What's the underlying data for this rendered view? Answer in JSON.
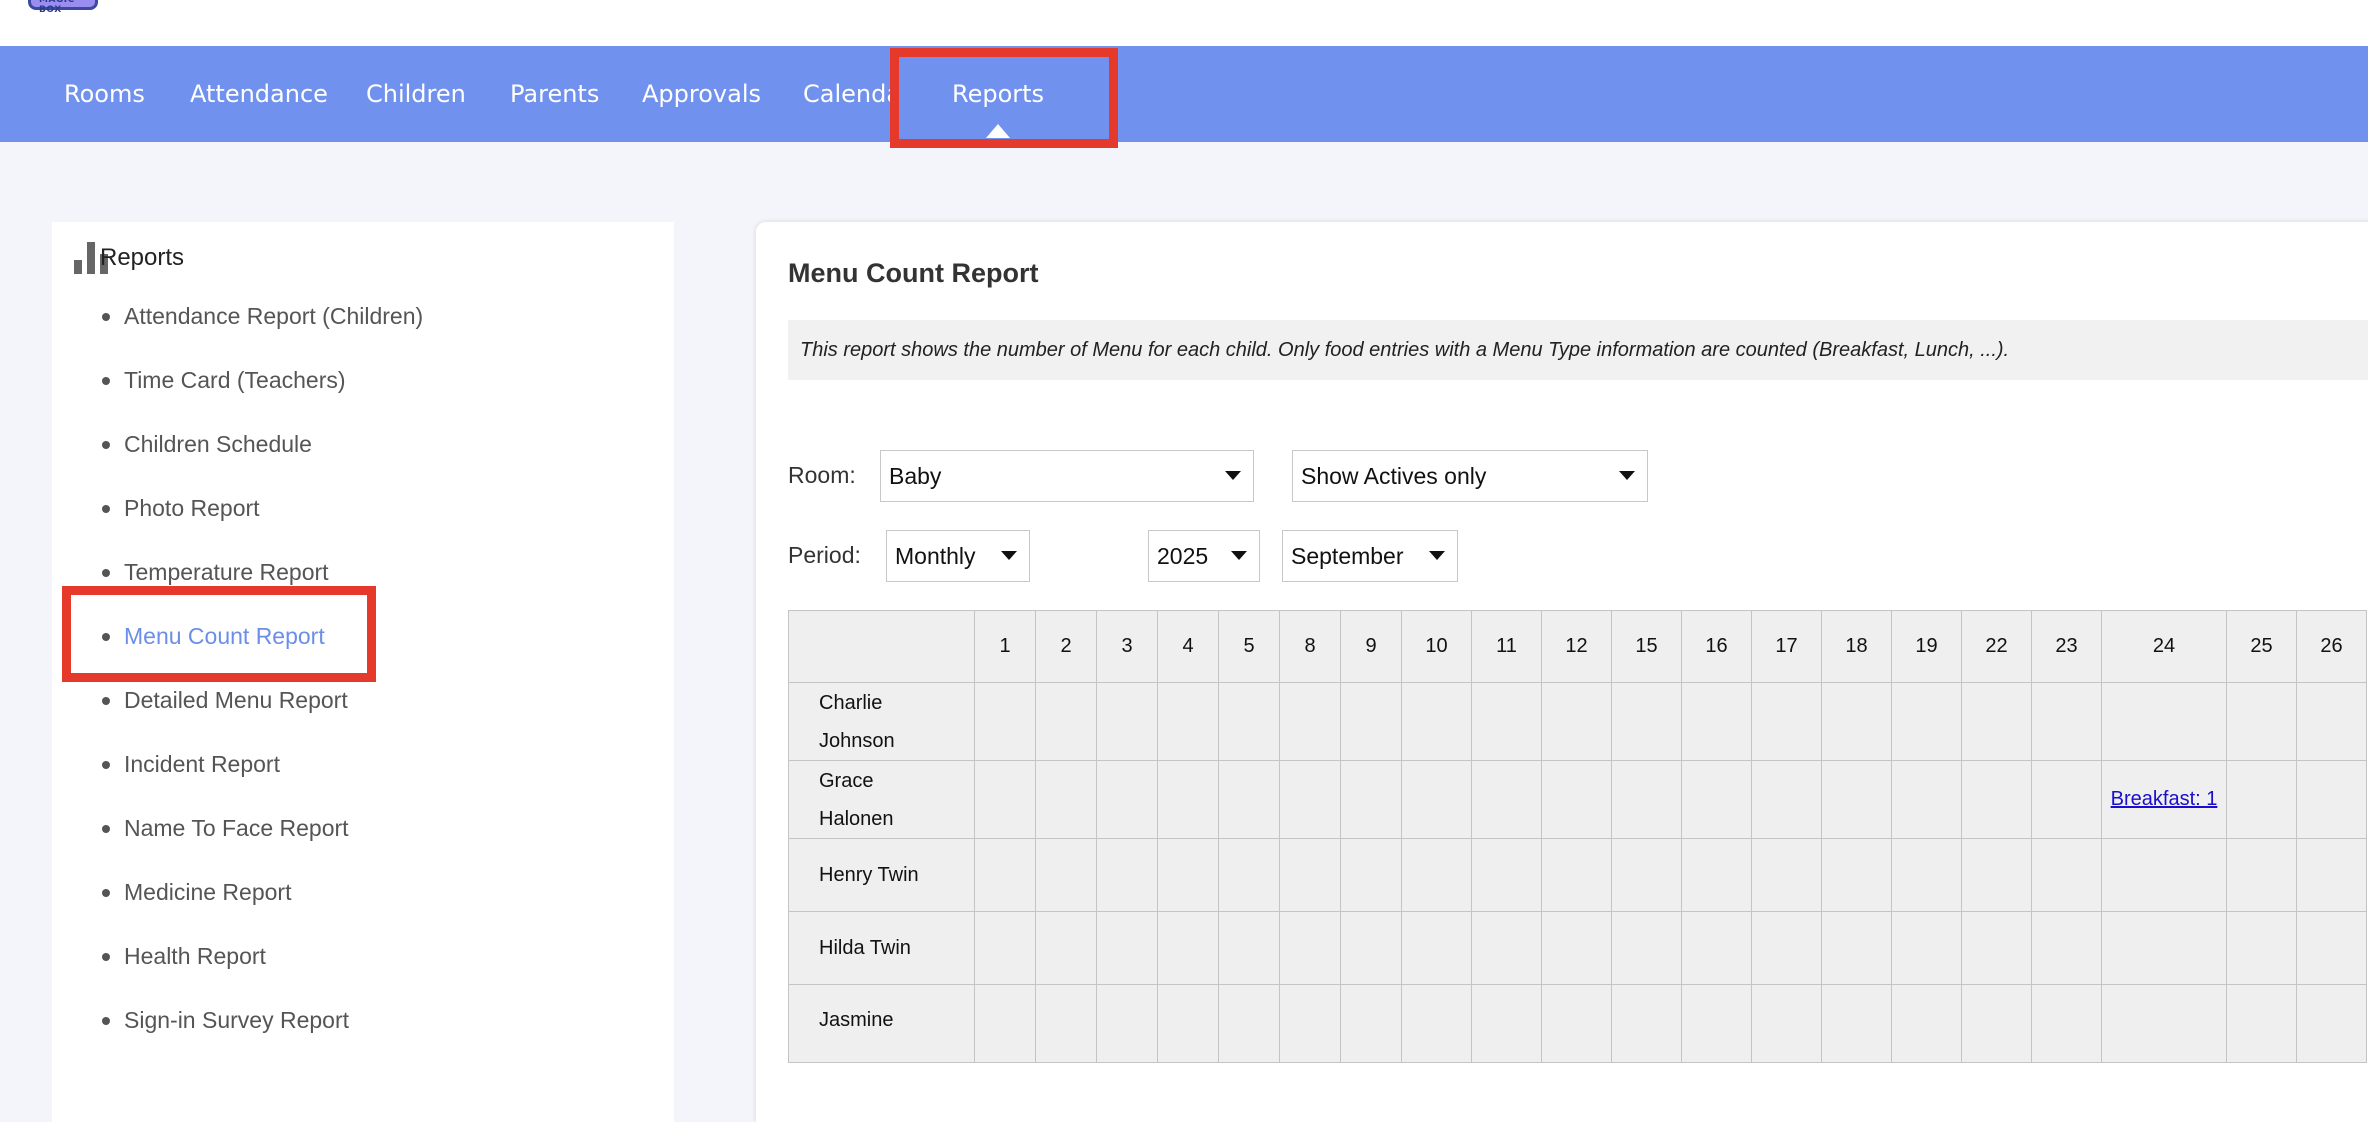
{
  "logo": {
    "text": "MAGIC BOX"
  },
  "nav": {
    "items": [
      "Rooms",
      "Attendance",
      "Children",
      "Parents",
      "Approvals",
      "Calendar",
      "Reports"
    ],
    "active": "Reports"
  },
  "sidebar": {
    "title": "Reports",
    "icon": "bar-chart-icon",
    "items": [
      "Attendance Report (Children)",
      "Time Card (Teachers)",
      "Children Schedule",
      "Photo Report",
      "Temperature Report",
      "Menu Count Report",
      "Detailed Menu Report",
      "Incident Report",
      "Name To Face Report",
      "Medicine Report",
      "Health Report",
      "Sign-in Survey Report"
    ],
    "active": "Menu Count Report"
  },
  "panel": {
    "title": "Menu Count Report",
    "description": "This report shows the number of Menu for each child. Only food entries with a Menu Type information are counted (Breakfast, Lunch, ...).",
    "room_label": "Room:",
    "room_value": "Baby",
    "status_value": "Show Actives only",
    "period_label": "Period:",
    "period_value": "Monthly",
    "year_value": "2025",
    "month_value": "September"
  },
  "table": {
    "days": [
      "1",
      "2",
      "3",
      "4",
      "5",
      "8",
      "9",
      "10",
      "11",
      "12",
      "15",
      "16",
      "17",
      "18",
      "19",
      "22",
      "23",
      "24",
      "25",
      "26"
    ],
    "rows": [
      {
        "name_line1": "Charlie",
        "name_line2": "Johnson",
        "cells": {}
      },
      {
        "name_line1": "Grace",
        "name_line2": "Halonen",
        "cells": {
          "24": "Breakfast: 1"
        }
      },
      {
        "name_line1": "Henry Twin",
        "name_line2": "",
        "cells": {}
      },
      {
        "name_line1": "Hilda Twin",
        "name_line2": "",
        "cells": {}
      },
      {
        "name_line1": "Jasmine",
        "name_line2": "",
        "cells": {}
      }
    ]
  },
  "colors": {
    "navbar": "#7191ee",
    "highlight": "#e53a2b",
    "active_link": "#6b8ee8"
  }
}
